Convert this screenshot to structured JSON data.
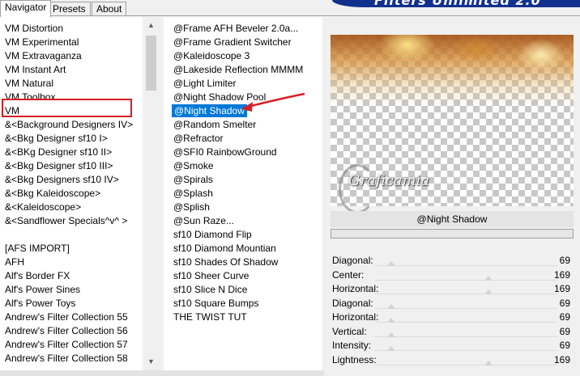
{
  "tabs": [
    "Navigator",
    "Presets",
    "About"
  ],
  "banner_title": "Filters Unlimited 2.0",
  "categories": [
    "VM Distortion",
    "VM Experimental",
    "VM Extravaganza",
    "VM Instant Art",
    "VM Natural",
    "VM Toolbox",
    "VM",
    "&<Background Designers IV>",
    "&<Bkg Designer sf10 I>",
    "&<BKg Designer sf10 II>",
    "&<Bkg Designer sf10 III>",
    "&<Bkg Designers sf10 IV>",
    "&<Bkg Kaleidoscope>",
    "&<Kaleidoscope>",
    "&<Sandflower Specials^v^ >",
    "",
    "[AFS IMPORT]",
    "AFH",
    "Alf's Border FX",
    "Alf's Power Sines",
    "Alf's Power Toys",
    "Andrew's Filter Collection 55",
    "Andrew's Filter Collection 56",
    "Andrew's Filter Collection 57",
    "Andrew's Filter Collection 58"
  ],
  "filters": [
    "@Frame AFH Beveler 2.0a...",
    "@Frame Gradient Switcher",
    "@Kaleidoscope 3",
    "@Lakeside Reflection MMMM",
    "@Light Limiter",
    "@Night Shadow Pool",
    "@Night Shadow",
    "@Random Smelter",
    "@Refractor",
    "@SFI0 RainbowGround",
    "@Smoke",
    "@Spirals",
    "@Splash",
    "@Splish",
    "@Sun Raze...",
    "sf10 Diamond Flip",
    "sf10 Diamond Mountian",
    "sf10 Shades Of Shadow",
    "sf10 Sheer Curve",
    "sf10 Slice N Dice",
    "sf10 Square Bumps",
    "THE TWIST TUT"
  ],
  "selected_filter": "@Night Shadow",
  "watermark_text": "Graficamia",
  "sliders": [
    {
      "label": "Diagonal:",
      "value": 69
    },
    {
      "label": "Center:",
      "value": 169
    },
    {
      "label": "Horizontal:",
      "value": 169
    },
    {
      "label": "Diagonal:",
      "value": 69
    },
    {
      "label": "Horizontal:",
      "value": 69
    },
    {
      "label": "Vertical:",
      "value": 69
    },
    {
      "label": "Intensity:",
      "value": 69
    },
    {
      "label": "Lightness:",
      "value": 169
    }
  ],
  "colors": {
    "selection": "#0078d7",
    "highlight_box": "#d81e24",
    "banner": "#12318f"
  }
}
